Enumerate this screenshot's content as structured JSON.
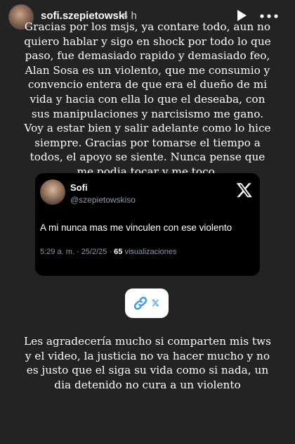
{
  "header": {
    "username": "sofi.szepietowski",
    "time": "4 h",
    "play_icon": "play-icon",
    "more_icon": "more-horizontal-icon"
  },
  "story": {
    "top_text": "Gracias por los msjs, ya contare todo, aun no quiero hablar y sigo en shock por todo lo que paso, fue demasiado rapido y demasiado feo, Alan Sosa es un violento, que me consumio y convencio entera de que era el dueño de mi vida y hacia con ella lo que el deseaba, con sus manipulaciones y narcisismo me gano. Voy a estar bien y salir adelante como lo hice siempre. Gracias por tomarse el tiempo a todos, el apoyo se siente. Nunca pense que me podia tocar y me toco.",
    "bottom_text": "Les agradecería mucho si comparten mis tws y el video, la justicia no va hacer mucho y no es justo que el siga su vida como si nada, un dia detenido no cura a un violento"
  },
  "tweet": {
    "name": "Sofi",
    "handle": "@szepietowskiso",
    "text": "A mi nunca mas me vinculen con ese violento",
    "time": "5:29 a. m. · 25/2/25 · ",
    "views_count": "65",
    "views_label": " visualizaciones",
    "logo_icon": "x-logo-icon"
  },
  "link_sticker": {
    "icon": "link-icon",
    "badge_icon": "x-logo-icon"
  },
  "colors": {
    "background": "#232323",
    "card": "#000000",
    "link_blue": "#3897f0",
    "muted": "#8b98a5"
  }
}
